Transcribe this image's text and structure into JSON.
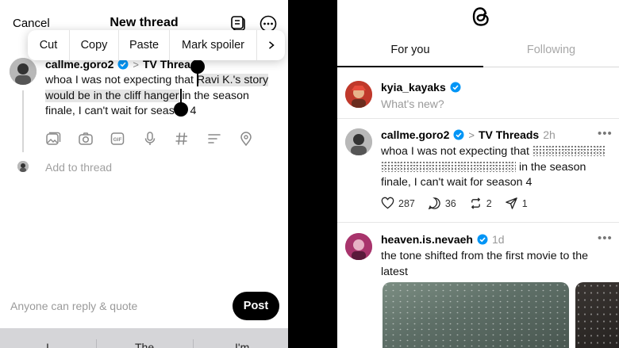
{
  "composer": {
    "cancel": "Cancel",
    "title": "New thread",
    "edit_menu": {
      "cut": "Cut",
      "copy": "Copy",
      "paste": "Paste",
      "mark_spoiler": "Mark spoiler"
    },
    "username": "callme.goro2",
    "topic": "TV Thread",
    "text_before": "whoa I was not expecting that ",
    "text_selected": "Ravi K.'s story would be in the cliff hanger",
    "text_after": " in the season finale, I can't wait for season 4",
    "add_to_thread": "Add to thread",
    "reply_hint": "Anyone can reply & quote",
    "post_button": "Post",
    "keyboard_suggestions": [
      "I",
      "The",
      "I'm"
    ]
  },
  "feed": {
    "tabs": {
      "for_you": "For you",
      "following": "Following",
      "active": "For you"
    },
    "composer_prompt": {
      "username": "kyia_kayaks",
      "placeholder": "What's new?"
    },
    "posts": [
      {
        "username": "callme.goro2",
        "topic": "TV Threads",
        "time": "2h",
        "text_before": "whoa I was not expecting that",
        "text_after": "in the season finale, I can't wait for season 4",
        "likes": "287",
        "comments": "36",
        "reposts": "2",
        "shares": "1"
      },
      {
        "username": "heaven.is.nevaeh",
        "time": "1d",
        "text": "the tone shifted from the first movie to the latest"
      }
    ]
  },
  "colors": {
    "verified": "#0095f6",
    "accent": "#000000",
    "muted": "#999999"
  }
}
